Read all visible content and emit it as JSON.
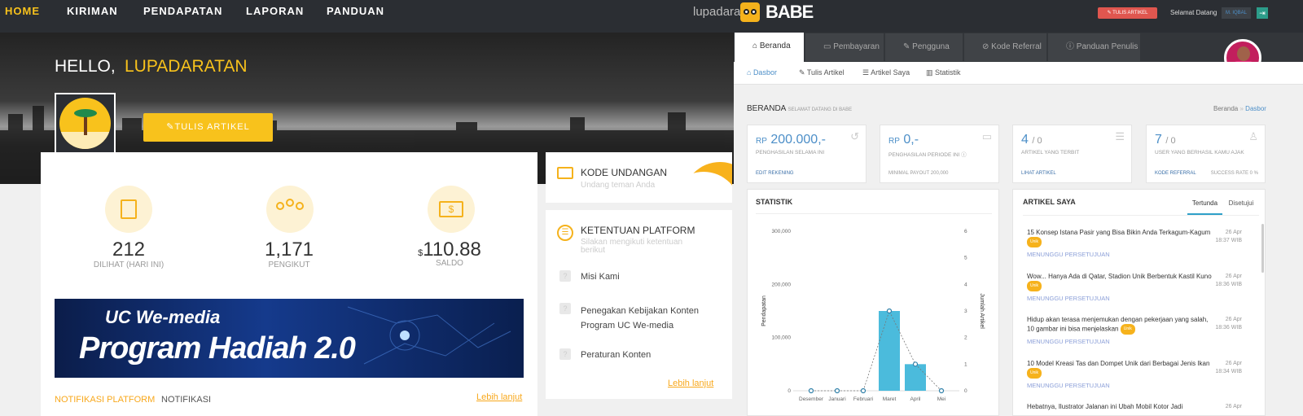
{
  "nav": {
    "home": "HOME",
    "kiriman": "KIRIMAN",
    "pendapatan": "PENDAPATAN",
    "laporan": "LAPORAN",
    "panduan": "PANDUAN"
  },
  "brand": {
    "name": "lupadara",
    "logo": "BABE"
  },
  "header": {
    "write_btn": "TULIS ARTIKEL",
    "welcome": "Selamat Datang",
    "user": "M. IQBAL"
  },
  "hero": {
    "hello": "HELLO,",
    "username": "LUPADARATAN",
    "write_btn": "TULIS ARTIKEL"
  },
  "stats": [
    {
      "value": "212",
      "label": "DILIHAT (HARI INI)",
      "icon": "certificate-icon"
    },
    {
      "value": "1,171",
      "label": "PENGIKUT",
      "icon": "followers-icon"
    },
    {
      "currency": "$",
      "value": "110.88",
      "label": "SALDO",
      "icon": "money-icon"
    }
  ],
  "banner": {
    "line1": "UC We-media",
    "line2": "Program Hadiah 2.0"
  },
  "notif": {
    "tab1": "NOTIFIKASI PLATFORM",
    "tab2": "NOTIFIKASI",
    "more": "Lebih lanjut"
  },
  "invite": {
    "title": "KODE UNDANGAN",
    "subtitle": "Undang teman Anda"
  },
  "rules": {
    "title": "KETENTUAN PLATFORM",
    "subtitle": "Silakan mengikuti ketentuan berikut",
    "items": [
      "Misi Kami",
      "Penegakan Kebijakan Konten Program UC We-media",
      "Peraturan Konten"
    ],
    "more": "Lebih lanjut"
  },
  "tabs": [
    "Beranda",
    "Pembayaran",
    "Pengguna",
    "Kode Referral",
    "Panduan Penulis"
  ],
  "subnav": [
    "Dasbor",
    "Tulis Artikel",
    "Artikel Saya",
    "Statistik"
  ],
  "page": {
    "title": "BERANDA",
    "subtitle": "SELAMAT DATANG DI BABE",
    "crumb1": "Beranda",
    "crumb_sep": "»",
    "crumb2": "Dasbor"
  },
  "kpis": [
    {
      "prefix": "RP",
      "value": "200.000,-",
      "label": "PENGHASILAN SELAMA INI",
      "action": "EDIT REKENING"
    },
    {
      "prefix": "RP",
      "value": "0,-",
      "label": "PENGHASILAN PERIODE INI",
      "action": "MINIMAL PAYOUT 200,000"
    },
    {
      "value": "4",
      "suffix": "/ 0",
      "label": "ARTIKEL YANG TERBIT",
      "action": "LIHAT ARTIKEL"
    },
    {
      "value": "7",
      "suffix": "/ 0",
      "label": "USER YANG BERHASIL KAMU AJAK",
      "action": "KODE REFERRAL",
      "extra": "SUCCESS RATE 0 %"
    }
  ],
  "statistik": {
    "title": "STATISTIK"
  },
  "chart_data": {
    "type": "bar",
    "categories": [
      "Desember",
      "Januari",
      "Februari",
      "Maret",
      "April",
      "Mei"
    ],
    "series": [
      {
        "name": "Pendapatan",
        "type": "bar",
        "values": [
          0,
          0,
          0,
          150000,
          50000,
          0
        ]
      },
      {
        "name": "Jumlah Artikel",
        "type": "line",
        "values": [
          0,
          0,
          0,
          3,
          1,
          0
        ]
      }
    ],
    "ylabel": "Pendapatan",
    "y2label": "Jumlah Artikel",
    "ylim": [
      0,
      300000
    ],
    "y2lim": [
      0,
      6
    ],
    "yticks": [
      "0",
      "100,000",
      "200,000",
      "300,000"
    ],
    "y2ticks": [
      "0",
      "1",
      "2",
      "3",
      "4",
      "5",
      "6"
    ],
    "bar_color": "#4bbbdc"
  },
  "articles": {
    "title": "ARTIKEL SAYA",
    "tab1": "Tertunda",
    "tab2": "Disetujui",
    "items": [
      {
        "title": "15 Konsep Istana Pasir yang Bisa Bikin Anda Terkagum-Kagum",
        "badge": "Unik",
        "status": "MENUNGGU PERSETUJUAN",
        "date": "26 Apr",
        "time": "18:37 WIB"
      },
      {
        "title": "Wow... Hanya Ada di Qatar, Stadion Unik Berbentuk Kastil Kuno",
        "badge": "Unik",
        "status": "MENUNGGU PERSETUJUAN",
        "date": "26 Apr",
        "time": "18:36 WIB"
      },
      {
        "title": "Hidup akan terasa menjemukan dengan pekerjaan yang salah, 10 gambar ini bisa menjelaskan",
        "badge": "Unik",
        "status": "MENUNGGU PERSETUJUAN",
        "date": "26 Apr",
        "time": "18:36 WIB"
      },
      {
        "title": "10 Model Kreasi Tas dan Dompet Unik dari Berbagai Jenis Ikan",
        "badge": "Unik",
        "status": "MENUNGGU PERSETUJUAN",
        "date": "26 Apr",
        "time": "18:34 WIB"
      },
      {
        "title": "Hebatnya, Ilustrator Jalanan ini Ubah Mobil Kotor Jadi",
        "date": "26 Apr"
      }
    ]
  },
  "colors": {
    "accent": "#f8c21c",
    "dark": "#2b2e33",
    "blue": "#4d8fc8",
    "red": "#e0564f",
    "bar": "#4bbbdc"
  }
}
